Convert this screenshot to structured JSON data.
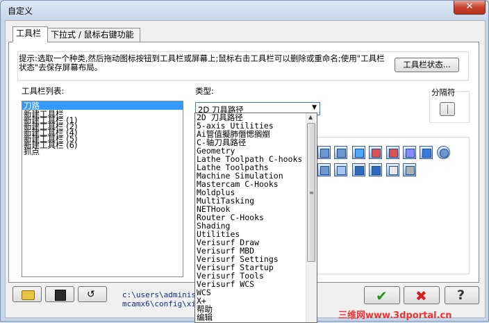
{
  "window": {
    "title": "自定义",
    "close_label": "✕"
  },
  "tabs": [
    {
      "label": "工具栏"
    },
    {
      "label": "下拉式 / 鼠标右键功能"
    }
  ],
  "hint": {
    "text": "提示:选取一个种类,然后拖动图标按钮到工具栏或屏幕上;鼠标右击工具栏可以删除或重命名;使用\"工具栏状态\"去保存屏幕布局。",
    "status_button": "工具栏状态..."
  },
  "toolbar_list": {
    "label": "工具栏列表:",
    "items": [
      "刀路",
      "新建工具栏",
      "新建工具栏 (1)",
      "新建工具栏 (2)",
      "新建工具栏 (4)",
      "新建工具栏 (5)",
      "新建工具栏 (6)",
      "抓点"
    ]
  },
  "category": {
    "label": "类型:",
    "selected": "2D 刀具路径",
    "options": [
      "2D 刀具路径",
      "5-axis Utilities",
      "Ai管值擬肺僭愢搁嬼",
      "C-轴刀具路径",
      "Geometry",
      "Lathe Toolpath C-hooks",
      "Lathe Toolpaths",
      "Machine Simulation",
      "Mastercam C-Hooks",
      "Moldplus",
      "MultiTasking",
      "NETHook",
      "Router C-Hooks",
      "Shading",
      "Utilities",
      "Verisurf Draw",
      "Verisurf MBD",
      "Verisurf Settings",
      "Verisurf Startup",
      "Verisurf Tools",
      "Verisurf WCS",
      "WCS",
      "X+",
      "帮助",
      "编辑"
    ]
  },
  "separator": {
    "label": "分隔符"
  },
  "footer": {
    "path_line1": "c:\\users\\administr",
    "path_line2": "mcamx6\\config\\xinl",
    "watermark": "三维网www.3dportal.cn"
  },
  "colors": {
    "selection": "#3399ff",
    "accent": "#3c7fb1",
    "ok": "#1e9b1e",
    "cancel": "#d42020"
  }
}
